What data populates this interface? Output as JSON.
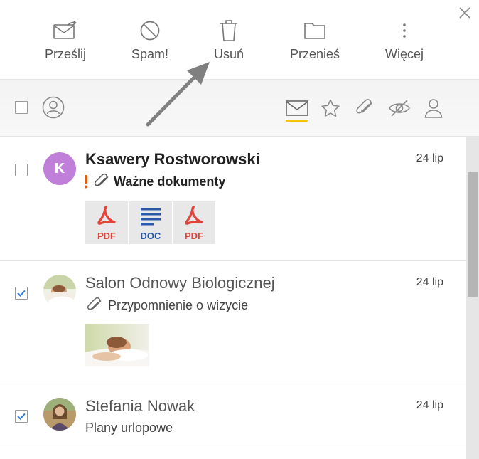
{
  "toolbar": {
    "forward_label": "Prześlij",
    "spam_label": "Spam!",
    "delete_label": "Usuń",
    "move_label": "Przenieś",
    "more_label": "Więcej"
  },
  "colors": {
    "accent_underline": "#f7c300",
    "avatar_k": "#c07fd9",
    "pdf_red": "#e0443a",
    "doc_blue": "#2b57a8",
    "important_orange": "#e8590c",
    "check_blue": "#2a7ad6"
  },
  "filters": {
    "icons": [
      "contacts-icon",
      "mail-icon",
      "star-icon",
      "paperclip-icon",
      "eye-off-icon",
      "person-icon"
    ]
  },
  "messages": [
    {
      "sender": "Ksawery Rostworowski",
      "avatar_letter": "K",
      "date": "24 lip",
      "subject": "Ważne dokumenty",
      "important": true,
      "has_attachment": true,
      "checked": false,
      "unread": true,
      "attachments": [
        {
          "ext": "PDF"
        },
        {
          "ext": "DOC"
        },
        {
          "ext": "PDF"
        }
      ]
    },
    {
      "sender": "Salon Odnowy Biologicznej",
      "date": "24 lip",
      "subject": "Przypomnienie o wizycie",
      "has_attachment": true,
      "checked": true,
      "unread": false
    },
    {
      "sender": "Stefania Nowak",
      "date": "24 lip",
      "subject": "Plany urlopowe",
      "checked": true,
      "unread": false
    }
  ]
}
